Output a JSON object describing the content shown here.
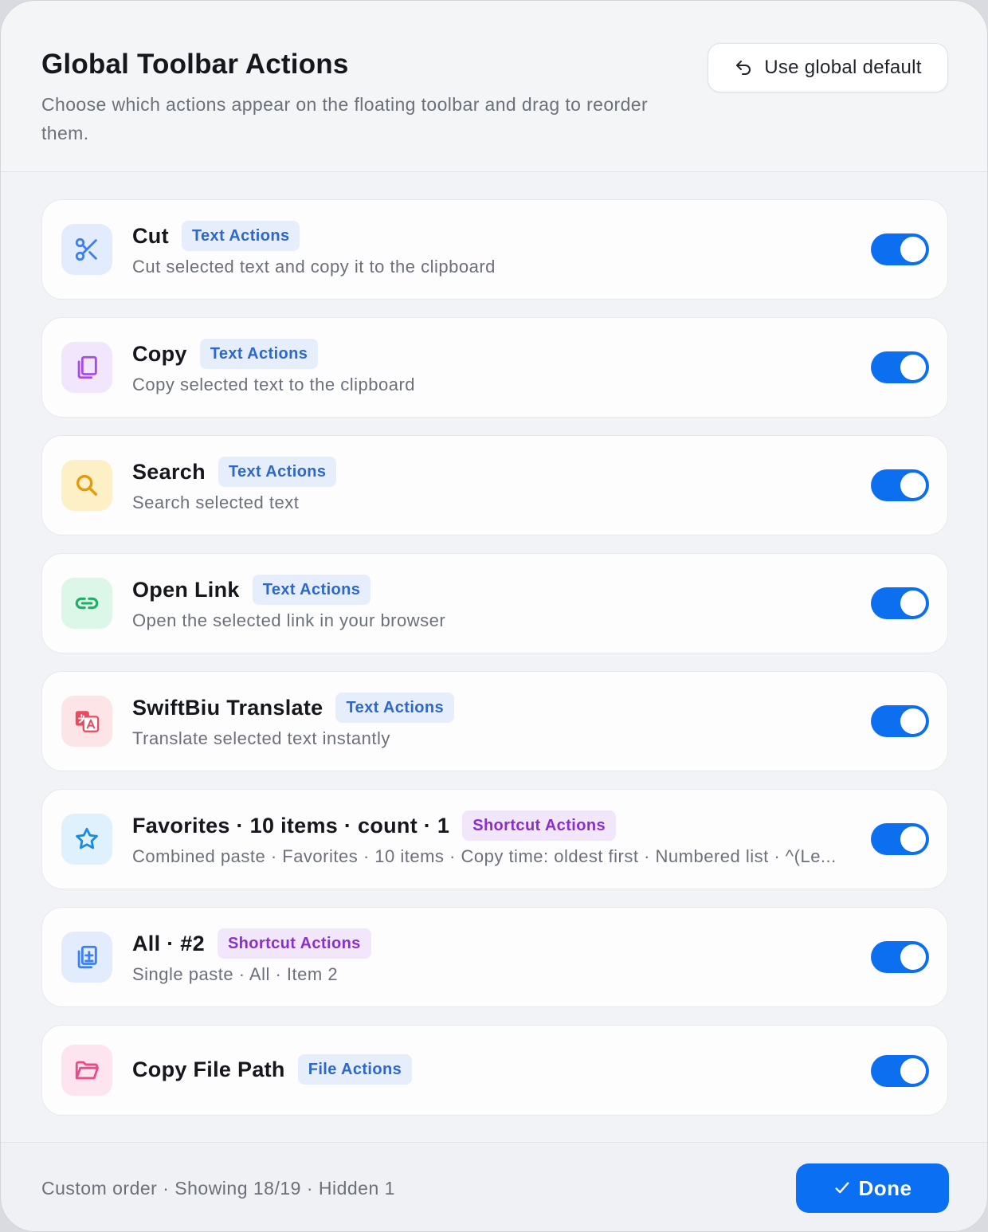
{
  "header": {
    "title": "Global Toolbar Actions",
    "subtitle": "Choose which actions appear on the floating toolbar and drag to reorder them.",
    "reset_label": "Use global default"
  },
  "actions": [
    {
      "name": "Cut",
      "tag": "Text Actions",
      "description": "Cut selected text and copy it to the clipboard",
      "enabled": true,
      "icon": "scissors-icon",
      "color": "#3b7ff0"
    },
    {
      "name": "Copy",
      "tag": "Text Actions",
      "description": "Copy selected text to the clipboard",
      "enabled": true,
      "icon": "copy-icon",
      "color": "#a44be8"
    },
    {
      "name": "Search",
      "tag": "Text Actions",
      "description": "Search selected text",
      "enabled": true,
      "icon": "search-icon",
      "color": "#e39a0c"
    },
    {
      "name": "Open Link",
      "tag": "Text Actions",
      "description": "Open the selected link in your browser",
      "enabled": true,
      "icon": "link-icon",
      "color": "#1fae66"
    },
    {
      "name": "SwiftBiu Translate",
      "tag": "Text Actions",
      "description": "Translate selected text instantly",
      "enabled": true,
      "icon": "translate-icon",
      "color": "#e84a5f"
    },
    {
      "name": "Favorites · 10 items · count · 1",
      "tag": "Shortcut Actions",
      "description": "Combined paste · Favorites · 10 items · Copy time: oldest first · Numbered list · ^(Le...",
      "enabled": true,
      "icon": "star-icon",
      "color": "#1a8ce0"
    },
    {
      "name": "All · #2",
      "tag": "Shortcut Actions",
      "description": "Single paste · All · Item 2",
      "enabled": true,
      "icon": "paste-document-icon",
      "color": "#3b7ff0"
    },
    {
      "name": "Copy File Path",
      "tag": "File Actions",
      "description": "",
      "enabled": true,
      "icon": "folder-icon",
      "color": "#e84a8a"
    }
  ],
  "footer": {
    "summary": "Custom order · Showing 18/19 · Hidden 1",
    "done_label": "Done"
  }
}
